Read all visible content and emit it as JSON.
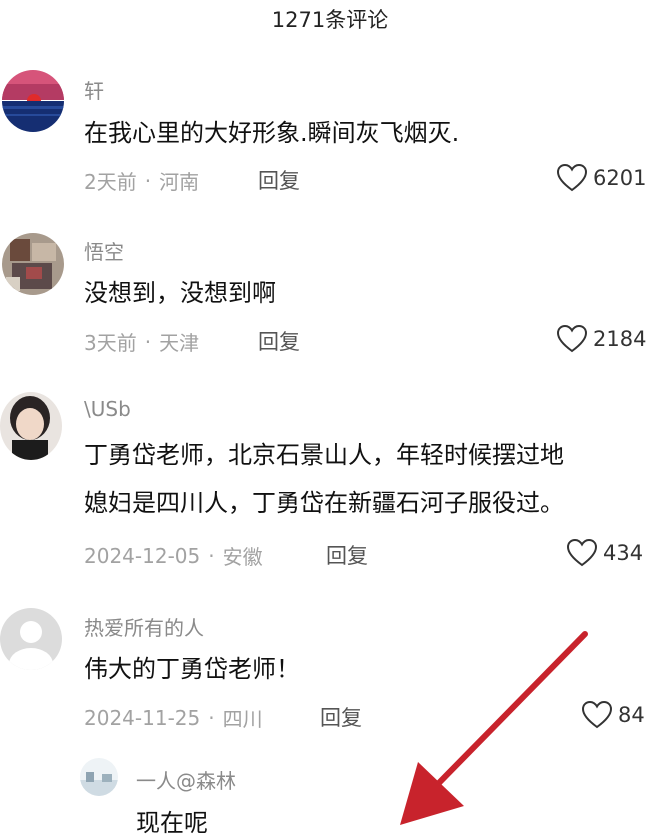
{
  "header": {
    "title": "1271条评论"
  },
  "comments": [
    {
      "username": "轩",
      "text": "在我心里的大好形象.瞬间灰飞烟灭.",
      "time": "2天前",
      "location": "河南",
      "reply_label": "回复",
      "likes": "6201",
      "avatar": "sunset-avatar"
    },
    {
      "username": "悟空",
      "text": "没想到，没想到啊",
      "time": "3天前",
      "location": "天津",
      "reply_label": "回复",
      "likes": "2184",
      "avatar": "photo-avatar"
    },
    {
      "username": "\\USb",
      "text_line1": "丁勇岱老师，北京石景山人，年轻时候摆过地",
      "text_line2": "媳妇是四川人，丁勇岱在新疆石河子服役过。",
      "time": "2024-12-05",
      "location": "安徽",
      "reply_label": "回复",
      "likes": "434",
      "avatar": "portrait-avatar"
    },
    {
      "username": "热爱所有的人",
      "text": "伟大的丁勇岱老师！",
      "time": "2024-11-25",
      "location": "四川",
      "reply_label": "回复",
      "likes": "84",
      "avatar": "default-avatar"
    }
  ],
  "sub_reply": {
    "username": "一人@森林",
    "text": "现在呢",
    "avatar": "landscape-avatar"
  },
  "colors": {
    "arrow": "#c8232c",
    "meta_text": "#a2a2a2",
    "username_text": "#8a8a8a"
  }
}
